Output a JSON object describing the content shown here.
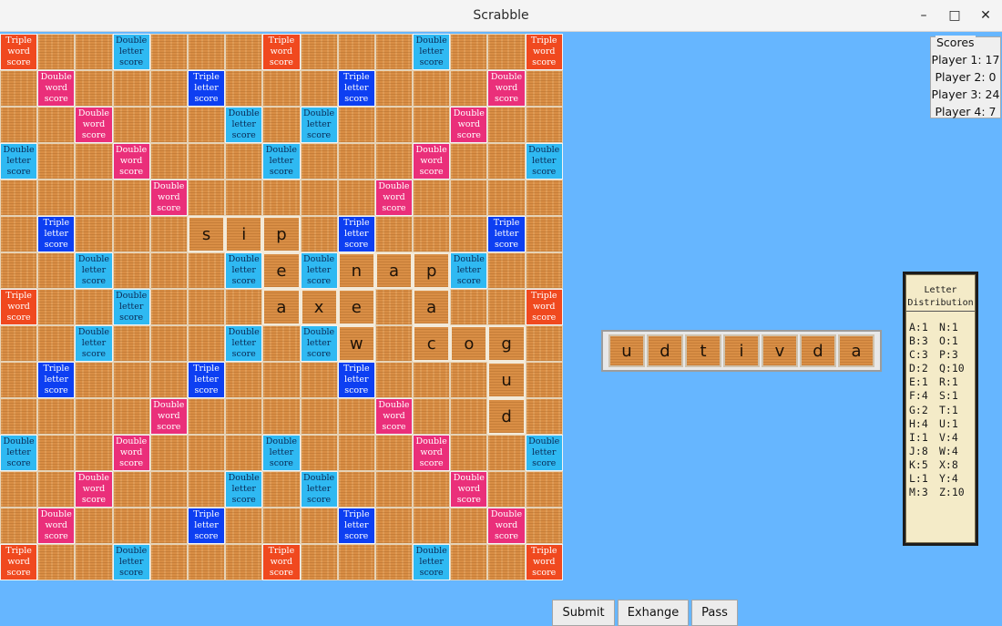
{
  "window": {
    "title": "Scrabble"
  },
  "window_controls": {
    "minimize": "–",
    "maximize": "□",
    "close": "✕"
  },
  "premium_labels": {
    "tw": "Triple\nword\nscore",
    "dw": "Double\nword\nscore",
    "tl": "Triple\nletter\nscore",
    "dl": "Double\nletter\nscore"
  },
  "board": {
    "rows": [
      [
        "tw",
        "",
        "",
        "dl",
        "",
        "",
        "",
        "tw",
        "",
        "",
        "",
        "dl",
        "",
        "",
        "tw"
      ],
      [
        "",
        "dw",
        "",
        "",
        "",
        "tl",
        "",
        "",
        "",
        "tl",
        "",
        "",
        "",
        "dw",
        ""
      ],
      [
        "",
        "",
        "dw",
        "",
        "",
        "",
        "dl",
        "",
        "dl",
        "",
        "",
        "",
        "dw",
        "",
        ""
      ],
      [
        "dl",
        "",
        "",
        "dw",
        "",
        "",
        "",
        "dl",
        "",
        "",
        "",
        "dw",
        "",
        "",
        "dl"
      ],
      [
        "",
        "",
        "",
        "",
        "dw",
        "",
        "",
        "",
        "",
        "",
        "dw",
        "",
        "",
        "",
        ""
      ],
      [
        "",
        "tl",
        "",
        "",
        "",
        "s",
        "i",
        "p",
        "",
        "tl",
        "",
        "",
        "",
        "tl",
        ""
      ],
      [
        "",
        "",
        "dl",
        "",
        "",
        "",
        "dl",
        "e",
        "dl",
        "n",
        "a",
        "p",
        "dl",
        "",
        ""
      ],
      [
        "tw",
        "",
        "",
        "dl",
        "",
        "",
        "",
        "a",
        "x",
        "e",
        "",
        "a",
        "",
        "",
        "tw"
      ],
      [
        "",
        "",
        "dl",
        "",
        "",
        "",
        "dl",
        "",
        "dl",
        "w",
        "",
        "c",
        "o",
        "g",
        ""
      ],
      [
        "",
        "tl",
        "",
        "",
        "",
        "tl",
        "",
        "",
        "",
        "tl",
        "",
        "",
        "",
        "u",
        ""
      ],
      [
        "",
        "",
        "",
        "",
        "dw",
        "",
        "",
        "",
        "",
        "",
        "dw",
        "",
        "",
        "d",
        ""
      ],
      [
        "dl",
        "",
        "",
        "dw",
        "",
        "",
        "",
        "dl",
        "",
        "",
        "",
        "dw",
        "",
        "",
        "dl"
      ],
      [
        "",
        "",
        "dw",
        "",
        "",
        "",
        "dl",
        "",
        "dl",
        "",
        "",
        "",
        "dw",
        "",
        ""
      ],
      [
        "",
        "dw",
        "",
        "",
        "",
        "tl",
        "",
        "",
        "",
        "tl",
        "",
        "",
        "",
        "dw",
        ""
      ],
      [
        "tw",
        "",
        "",
        "dl",
        "",
        "",
        "",
        "tw",
        "",
        "",
        "",
        "dl",
        "",
        "",
        "tw"
      ]
    ]
  },
  "scores": {
    "legend": "Scores",
    "players": [
      "Player 1: 17",
      "Player 2: 0",
      "Player 3: 24",
      "Player 4: 7"
    ]
  },
  "rack": {
    "tiles": [
      "u",
      "d",
      "t",
      "i",
      "v",
      "d",
      "a"
    ]
  },
  "distribution": {
    "title_line1": "Letter",
    "title_line2": "Distribution",
    "left": [
      "A:1",
      "B:3",
      "C:3",
      "D:2",
      "E:1",
      "F:4",
      "G:2",
      "H:4",
      "I:1",
      "J:8",
      "K:5",
      "L:1",
      "M:3"
    ],
    "right": [
      "N:1",
      "O:1",
      "P:3",
      "Q:10",
      "R:1",
      "S:1",
      "T:1",
      "U:1",
      "V:4",
      "W:4",
      "X:8",
      "Y:4",
      "Z:10"
    ]
  },
  "buttons": {
    "submit": "Submit",
    "exchange": "Exhange",
    "pass": "Pass"
  }
}
